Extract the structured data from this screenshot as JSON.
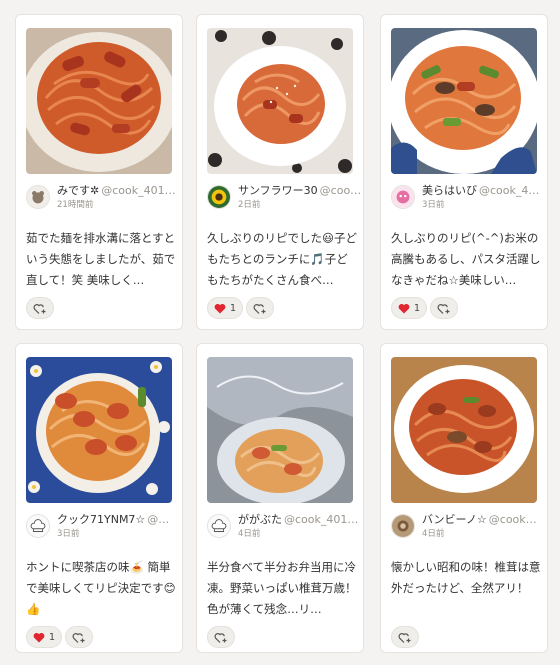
{
  "cards": [
    {
      "author_name": "みです✲",
      "author_id": "@cook_401…",
      "time": "21時間前",
      "comment": "茹でた麺を排水溝に落とすという失態をしましたが、茹で直して！笑 美味しく…",
      "likes": "",
      "avatar_icon": "bear-doodle-avatar",
      "colors": {
        "plate": "#e9e1d8",
        "pasta": "#cf5a2a"
      }
    },
    {
      "author_name": "サンフラワー30",
      "author_id": "@coo…",
      "time": "2日前",
      "comment": "久しぶりのリピでした😃子どもたちとのランチに🎵子どもたちがたくさん食べ…",
      "likes": "1",
      "avatar_icon": "sunflower-avatar",
      "colors": {
        "plate": "#ffffff",
        "pasta": "#d86a3a"
      }
    },
    {
      "author_name": "美らはいび",
      "author_id": "@cook_4…",
      "time": "3日前",
      "comment": "久しぶりのリピ(^-^)お米の高騰もあるし、パスタ活躍しなきゃだね☆美味しい…",
      "likes": "1",
      "avatar_icon": "pink-character-avatar",
      "colors": {
        "plate": "#ffffff",
        "pasta": "#e0783e"
      }
    },
    {
      "author_name": "クック71YNM7☆",
      "author_id": "@…",
      "time": "3日前",
      "comment": "ホントに喫茶店の味🍝 簡単で美味しくてリピ決定です😊👍",
      "likes": "1",
      "avatar_icon": "chef-hat-avatar",
      "colors": {
        "plate": "#2b4c9b",
        "pasta": "#e08a3c"
      }
    },
    {
      "author_name": "ががぶた",
      "author_id": "@cook_401…",
      "time": "4日前",
      "comment": "半分食べて半分お弁当用に冷凍。野菜いっぱい椎茸万歳！ 色が薄くて残念…リ…",
      "likes": "",
      "avatar_icon": "chef-hat-avatar",
      "colors": {
        "plate": "#d8dde2",
        "pasta": "#e2a05a"
      }
    },
    {
      "author_name": "バンビーノ☆",
      "author_id": "@cook…",
      "time": "4日前",
      "comment": "懐かしい昭和の味！椎茸は意外だったけど、全然アリ！",
      "likes": "",
      "avatar_icon": "photo-avatar",
      "colors": {
        "plate": "#ffffff",
        "pasta": "#c9542a"
      }
    }
  ],
  "icons": {
    "heart": "heart-icon",
    "add_heart": "heart-plus-icon"
  }
}
